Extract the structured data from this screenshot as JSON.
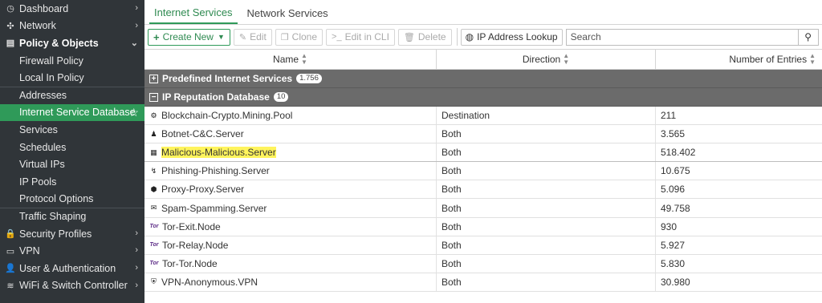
{
  "sidebar": {
    "items": [
      {
        "label": "Dashboard",
        "icon": "dashboard-icon",
        "glyph": "◷",
        "type": "top",
        "chevron": "›"
      },
      {
        "label": "Network",
        "icon": "network-icon",
        "glyph": "✣",
        "type": "top",
        "chevron": "›"
      },
      {
        "label": "Policy & Objects",
        "icon": "policy-icon",
        "glyph": "▤",
        "type": "top-open",
        "chevron": "⌄"
      },
      {
        "label": "Firewall Policy",
        "type": "sub"
      },
      {
        "label": "Local In Policy",
        "type": "sub"
      },
      {
        "label": "Addresses",
        "type": "sub-sep"
      },
      {
        "label": "Internet Service Database",
        "type": "sub-active"
      },
      {
        "label": "Services",
        "type": "sub"
      },
      {
        "label": "Schedules",
        "type": "sub"
      },
      {
        "label": "Virtual IPs",
        "type": "sub"
      },
      {
        "label": "IP Pools",
        "type": "sub"
      },
      {
        "label": "Protocol Options",
        "type": "sub"
      },
      {
        "label": "Traffic Shaping",
        "type": "sub-sep"
      },
      {
        "label": "Security Profiles",
        "icon": "lock-icon",
        "glyph": "🔒",
        "type": "top",
        "chevron": "›"
      },
      {
        "label": "VPN",
        "icon": "vpn-icon",
        "glyph": "▭",
        "type": "top",
        "chevron": "›"
      },
      {
        "label": "User & Authentication",
        "icon": "user-icon",
        "glyph": "👤",
        "type": "top",
        "chevron": "›"
      },
      {
        "label": "WiFi & Switch Controller",
        "icon": "wifi-icon",
        "glyph": "≋",
        "type": "top",
        "chevron": "›"
      }
    ]
  },
  "tabs": [
    {
      "label": "Internet Services",
      "active": true
    },
    {
      "label": "Network Services",
      "active": false
    }
  ],
  "toolbar": {
    "create_label": "Create New",
    "edit_label": "Edit",
    "clone_label": "Clone",
    "edit_cli_label": "Edit in CLI",
    "delete_label": "Delete",
    "lookup_label": "IP Address Lookup",
    "search_placeholder": "Search"
  },
  "table": {
    "columns": [
      "Name",
      "Direction",
      "Number of Entries"
    ],
    "groups": [
      {
        "label": "Predefined Internet Services",
        "count": "1.756",
        "toggle": "+",
        "rows": []
      },
      {
        "label": "IP Reputation Database",
        "count": "10",
        "toggle": "−",
        "rows": [
          {
            "name": "Blockchain-Crypto.Mining.Pool",
            "direction": "Destination",
            "entries": "211",
            "icon": "crypto-icon",
            "glyph": "⚙"
          },
          {
            "name": "Botnet-C&C.Server",
            "direction": "Both",
            "entries": "3.565",
            "icon": "botnet-icon",
            "glyph": "♟"
          },
          {
            "name": "Malicious-Malicious.Server",
            "direction": "Both",
            "entries": "518.402",
            "icon": "malicious-icon",
            "glyph": "▦",
            "highlighted": true
          },
          {
            "name": "Phishing-Phishing.Server",
            "direction": "Both",
            "entries": "10.675",
            "icon": "phishing-icon",
            "glyph": "↯"
          },
          {
            "name": "Proxy-Proxy.Server",
            "direction": "Both",
            "entries": "5.096",
            "icon": "proxy-icon",
            "glyph": "⬢"
          },
          {
            "name": "Spam-Spamming.Server",
            "direction": "Both",
            "entries": "49.758",
            "icon": "spam-icon",
            "glyph": "✉"
          },
          {
            "name": "Tor-Exit.Node",
            "direction": "Both",
            "entries": "930",
            "icon": "tor-icon",
            "glyph": "Tor"
          },
          {
            "name": "Tor-Relay.Node",
            "direction": "Both",
            "entries": "5.927",
            "icon": "tor-icon",
            "glyph": "Tor"
          },
          {
            "name": "Tor-Tor.Node",
            "direction": "Both",
            "entries": "5.830",
            "icon": "tor-icon",
            "glyph": "Tor"
          },
          {
            "name": "VPN-Anonymous.VPN",
            "direction": "Both",
            "entries": "30.980",
            "icon": "vpn-shield-icon",
            "glyph": "⛨"
          }
        ]
      }
    ]
  },
  "colors": {
    "sidebar_bg": "#303539",
    "accent_green": "#2f9a59",
    "group_row_bg": "#6b6b6b",
    "highlight": "#fff45c"
  }
}
